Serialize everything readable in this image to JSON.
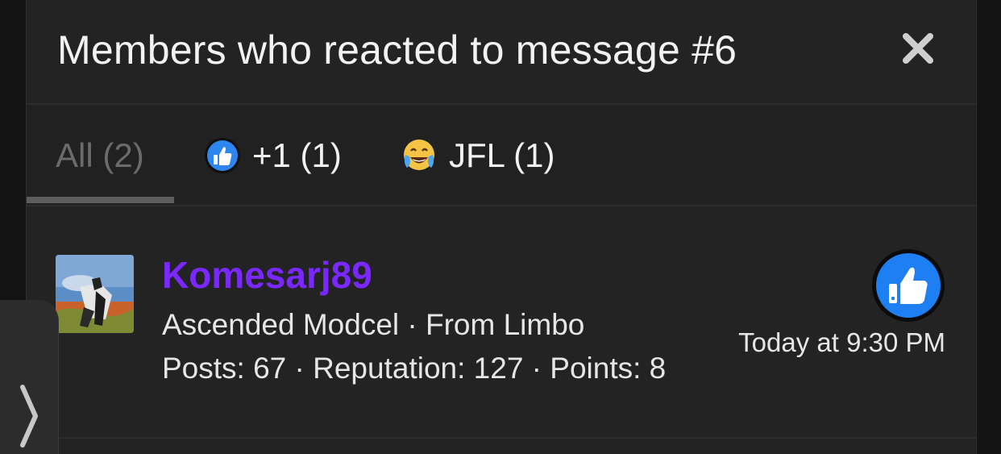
{
  "modal": {
    "title": "Members who reacted to message #6",
    "close_icon": "close-icon"
  },
  "tabs": [
    {
      "label": "All (2)",
      "icon": null,
      "active": true
    },
    {
      "label": "+1 (1)",
      "icon": "thumbs-up-emoji-icon",
      "active": false
    },
    {
      "label": "JFL (1)",
      "icon": "tears-of-joy-emoji-icon",
      "active": false
    }
  ],
  "members": [
    {
      "username": "Komesarj89",
      "title_line": "Ascended Modcel · From Limbo",
      "stats_line": "Posts: 67 · Reputation: 127 · Points: 8",
      "reaction_icon": "thumbs-up-reaction-icon",
      "reaction_time": "Today at 9:30 PM"
    }
  ],
  "colors": {
    "username": "#7a28ff",
    "reaction_blue": "#1d7ff2",
    "background": "#232323"
  },
  "side_handle": {
    "icon": "chevron-right-icon"
  }
}
